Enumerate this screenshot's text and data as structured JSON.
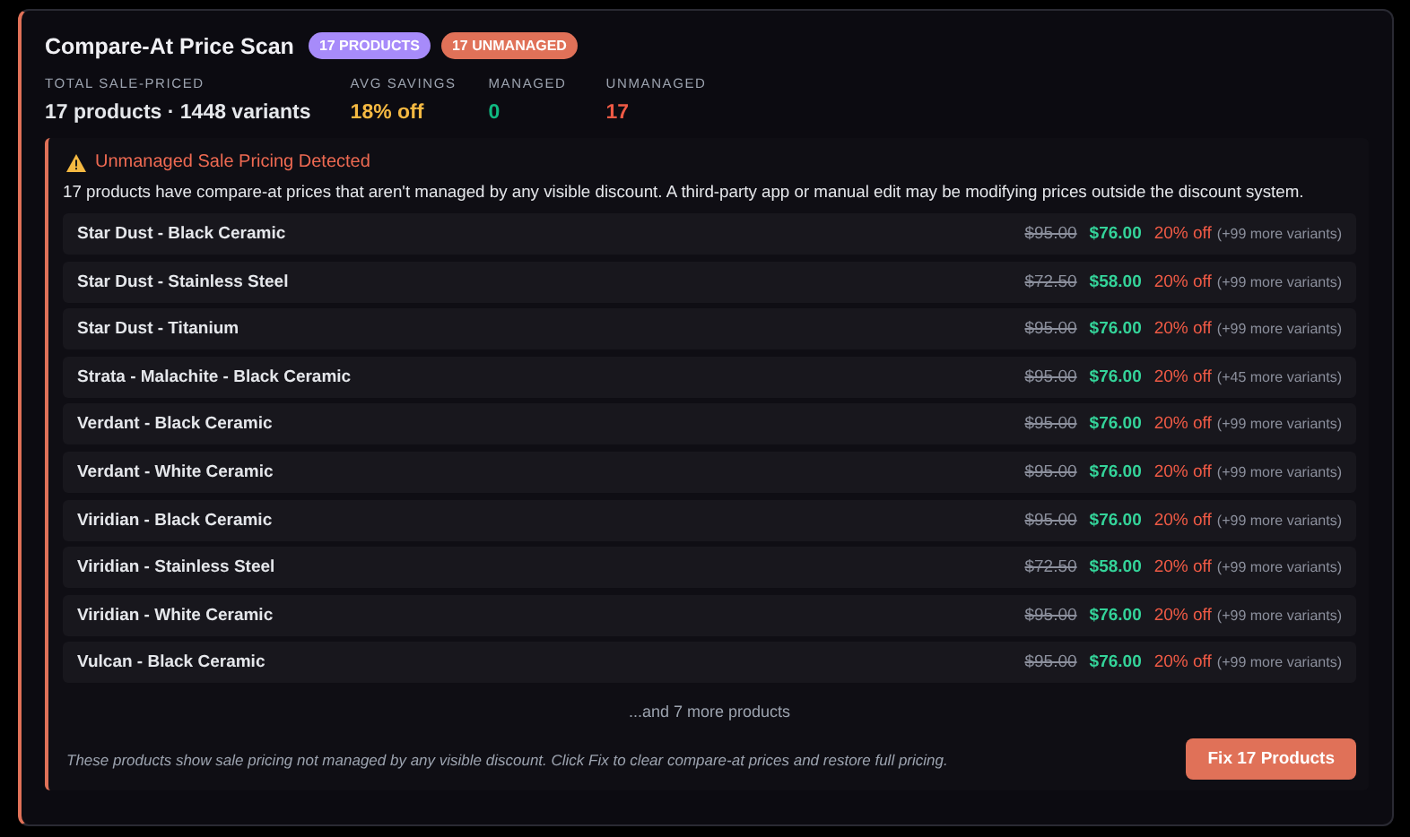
{
  "title": "Compare-At Price Scan",
  "badges": [
    {
      "label": "17 PRODUCTS",
      "color": "#a78bfa"
    },
    {
      "label": "17 UNMANAGED",
      "color": "#e07158"
    }
  ],
  "stats": [
    {
      "label": "TOTAL SALE-PRICED",
      "value": "17 products · 1448 variants",
      "color": "#e5e7eb"
    },
    {
      "label": "AVG SAVINGS",
      "value": "18% off",
      "color": "#f5b942"
    },
    {
      "label": "MANAGED",
      "value": "0",
      "color": "#10b981"
    },
    {
      "label": "UNMANAGED",
      "value": "17",
      "color": "#ef5a45"
    }
  ],
  "alert": {
    "title": "Unmanaged Sale Pricing Detected",
    "message": "17 products have compare-at prices that aren't managed by any visible discount. A third-party app or manual edit may be modifying prices outside the discount system.",
    "rows": [
      {
        "name": "Star Dust - Black Ceramic",
        "was": "$95.00",
        "now": "$76.00",
        "off": "20% off",
        "more": "(+99 more variants)"
      },
      {
        "name": "Star Dust - Stainless Steel",
        "was": "$72.50",
        "now": "$58.00",
        "off": "20% off",
        "more": "(+99 more variants)"
      },
      {
        "name": "Star Dust - Titanium",
        "was": "$95.00",
        "now": "$76.00",
        "off": "20% off",
        "more": "(+99 more variants)"
      },
      {
        "name": "Strata - Malachite - Black Ceramic",
        "was": "$95.00",
        "now": "$76.00",
        "off": "20% off",
        "more": "(+45 more variants)"
      },
      {
        "name": "Verdant - Black Ceramic",
        "was": "$95.00",
        "now": "$76.00",
        "off": "20% off",
        "more": "(+99 more variants)"
      },
      {
        "name": "Verdant - White Ceramic",
        "was": "$95.00",
        "now": "$76.00",
        "off": "20% off",
        "more": "(+99 more variants)"
      },
      {
        "name": "Viridian - Black Ceramic",
        "was": "$95.00",
        "now": "$76.00",
        "off": "20% off",
        "more": "(+99 more variants)"
      },
      {
        "name": "Viridian - Stainless Steel",
        "was": "$72.50",
        "now": "$58.00",
        "off": "20% off",
        "more": "(+99 more variants)"
      },
      {
        "name": "Viridian - White Ceramic",
        "was": "$95.00",
        "now": "$76.00",
        "off": "20% off",
        "more": "(+99 more variants)"
      },
      {
        "name": "Vulcan - Black Ceramic",
        "was": "$95.00",
        "now": "$76.00",
        "off": "20% off",
        "more": "(+99 more variants)"
      }
    ],
    "more_products": "...and 7 more products",
    "footer_note": "These products show sale pricing not managed by any visible discount. Click Fix to clear compare-at prices and restore full pricing.",
    "button": "Fix 17 Products"
  }
}
